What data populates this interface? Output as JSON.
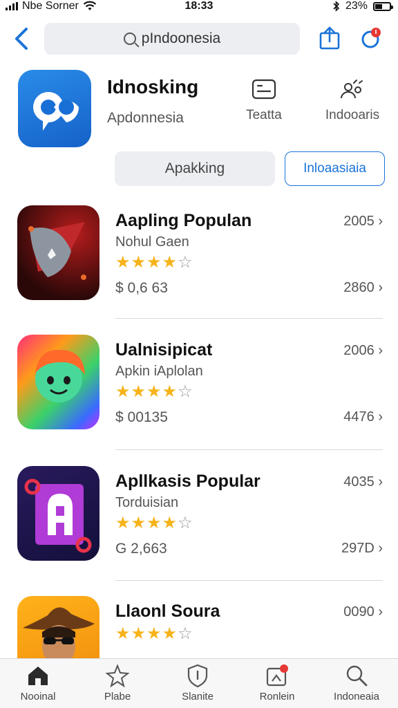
{
  "status": {
    "carrier": "Nbe Sorner",
    "time": "18:33",
    "battery": "23%"
  },
  "nav": {
    "search_text": "pIndoonesia"
  },
  "header": {
    "title": "Idnosking",
    "subtitle": "Apdonnesia",
    "meta1_label": "Teatta",
    "meta2_label": "Indooaris",
    "primary_button": "Apakking",
    "secondary_button": "Inloaasiaia"
  },
  "apps": [
    {
      "title": "Aapling Populan",
      "subtitle": "Nohul Gaen",
      "price": "$ 0,6 63",
      "num1": "2005",
      "num2": "2860",
      "rating": 4
    },
    {
      "title": "Ualnisipicat",
      "subtitle": "Apkin iAplolan",
      "price": "$ 00135",
      "num1": "2006",
      "num2": "4476",
      "rating": 4
    },
    {
      "title": "Apllkasis Popular",
      "subtitle": "Torduisian",
      "price": "G 2,663",
      "num1": "4035",
      "num2": "297D",
      "rating": 4
    },
    {
      "title": "Llaonl Soura",
      "subtitle": "",
      "price": "",
      "num1": "0090",
      "num2": "",
      "rating": 4
    }
  ],
  "tabs": [
    {
      "label": "Nooinal",
      "icon": "house-icon"
    },
    {
      "label": "Plabe",
      "icon": "star-icon"
    },
    {
      "label": "Slanite",
      "icon": "shield-icon"
    },
    {
      "label": "Ronlein",
      "icon": "updates-icon"
    },
    {
      "label": "Indoneaia",
      "icon": "search-icon"
    }
  ],
  "colors": {
    "accent": "#1a73d9",
    "star": "#f6b31a",
    "badge": "#e53935"
  }
}
